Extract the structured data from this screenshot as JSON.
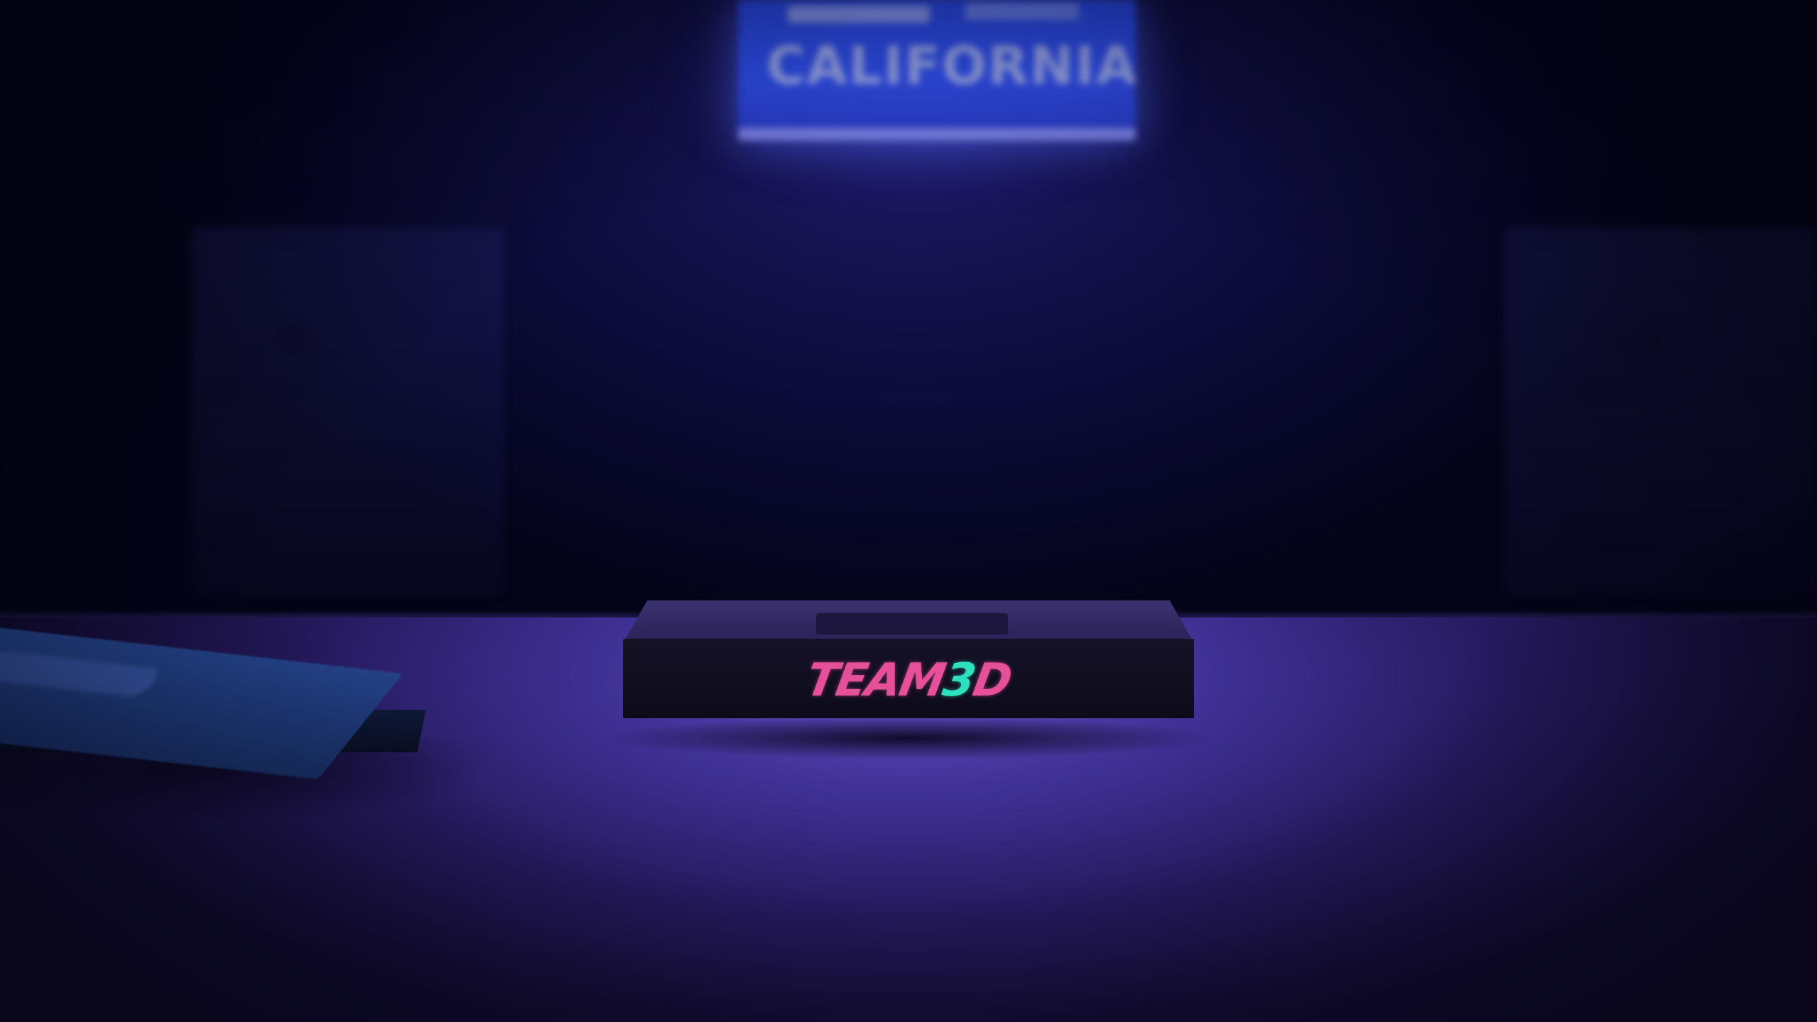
{
  "scene": {
    "poster": {
      "text": "CALIFORNIA"
    },
    "tape": {
      "logo_team": "TEAM",
      "logo_three": "3",
      "logo_d": "D"
    },
    "colors": {
      "background": "#07072a",
      "table": "#3e2f92",
      "logo_pink": "#e6509b",
      "logo_teal": "#2fe0c0",
      "poster_blue": "#3355ff",
      "book_blue": "#1f3a7a"
    }
  }
}
